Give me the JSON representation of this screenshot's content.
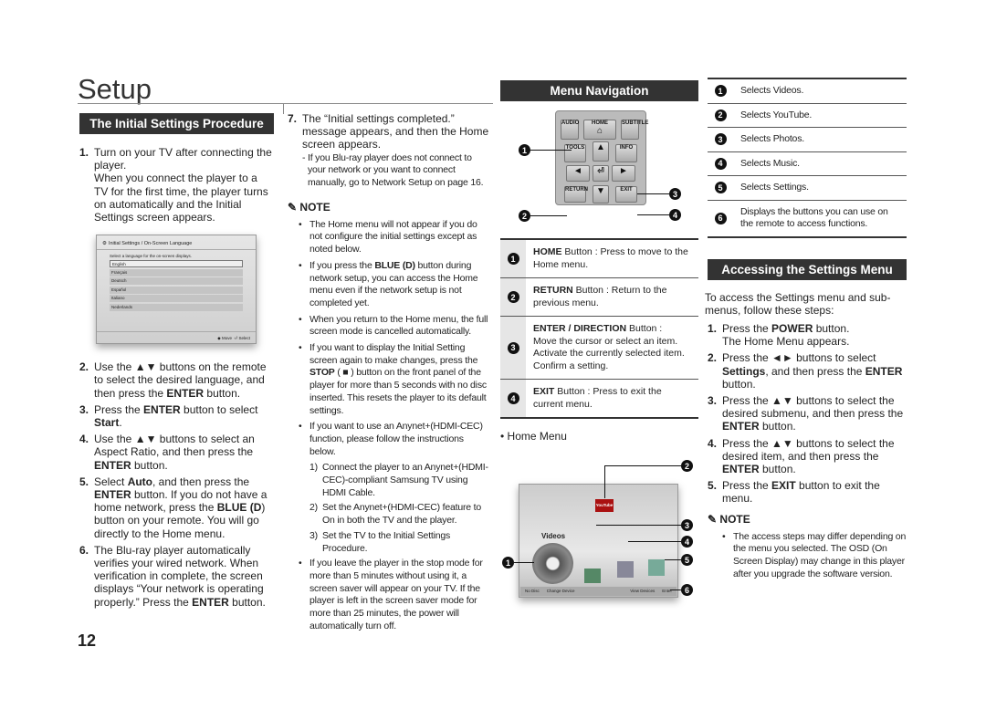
{
  "page": {
    "title": "Setup",
    "number": "12"
  },
  "initial": {
    "header": "The Initial Settings Procedure",
    "steps": [
      {
        "n": "1.",
        "segs": [
          "Turn on your TV after connecting the player.",
          "\nWhen you connect the player to a TV for the first time, the player turns on automatically and the Initial Settings screen appears."
        ]
      },
      {
        "n": "2.",
        "segs": [
          "Use the ▲▼ buttons on the remote to select the desired language, and then press the ",
          {
            "b": "ENTER"
          },
          " button."
        ]
      },
      {
        "n": "3.",
        "segs": [
          "Press the ",
          {
            "b": "ENTER"
          },
          " button to select ",
          {
            "b": "Start"
          },
          "."
        ]
      },
      {
        "n": "4.",
        "segs": [
          "Use the ▲▼ buttons to select an Aspect Ratio, and then press the ",
          {
            "b": "ENTER"
          },
          " button."
        ]
      },
      {
        "n": "5.",
        "segs": [
          "Select ",
          {
            "b": "Auto"
          },
          ", and then press the ",
          {
            "b": "ENTER"
          },
          " button. If you do not have a home network, press the ",
          {
            "b": "BLUE (D"
          },
          ") button on your remote. You will go directly to the Home menu."
        ]
      },
      {
        "n": "6.",
        "segs": [
          "The Blu-ray player automatically verifies your wired network. When verification in complete, the screen displays “Your network is operating properly.” Press the ",
          {
            "b": "ENTER"
          },
          " button."
        ]
      }
    ],
    "screen": {
      "title": "Initial Settings / On-Screen Language",
      "prompt": "Select a language for the on-screen displays.",
      "languages": [
        "English",
        "Français",
        "Deutsch",
        "Español",
        "Italiano",
        "Nederlands"
      ],
      "move": "◆ Move",
      "select": "⏎ Select"
    }
  },
  "col2": {
    "step7": {
      "n": "7.",
      "text": "The “Initial settings completed.” message appears, and then the Home screen appears.",
      "sub": "- If you Blu-ray player does not connect to your network or you want to connect manually, go to Network Setup on page 16."
    },
    "note_label": "NOTE",
    "bullets": [
      [
        "The Home menu will not appear if you do not configure the initial settings except as noted below."
      ],
      [
        "If you press the ",
        {
          "b": "BLUE (D)"
        },
        " button during network setup, you can access the Home menu even if the network setup is not completed yet."
      ],
      [
        "When you return to the Home menu, the full screen mode is cancelled automatically."
      ],
      [
        "If you want to display the Initial Setting screen again to make changes, press the ",
        {
          "b": "STOP"
        },
        " ( ■ ) button on the front panel of the player for more than 5 seconds with no disc inserted. This resets the player to its default settings."
      ],
      [
        "If you want to use an Anynet+(HDMI-CEC) function, please follow the instructions below."
      ]
    ],
    "anynet_steps": [
      {
        "n": "1)",
        "text": "Connect the player to an Anynet+(HDMI-CEC)-compliant Samsung TV using HDMI Cable."
      },
      {
        "n": "2)",
        "text": "Set the Anynet+(HDMI-CEC) feature to On in both the TV and the player."
      },
      {
        "n": "3)",
        "text": "Set the TV to the Initial Settings Procedure."
      }
    ],
    "last_bullet": "If you leave the player in the stop mode for more than 5 minutes without using it, a screen saver will appear on your TV. If the player is left in the screen saver mode for more than 25 minutes, the power will automatically turn off."
  },
  "menu_nav": {
    "header": "Menu Navigation",
    "remote": {
      "audio": "AUDIO",
      "home": "HOME",
      "subtitle": "SUBTITLE",
      "tools": "TOOLS",
      "info": "INFO",
      "return": "RETURN",
      "exit": "EXIT"
    },
    "callouts": [
      "1",
      "2",
      "3",
      "4"
    ],
    "rows": [
      {
        "n": "1",
        "segs": [
          {
            "b": "HOME"
          },
          " Button : Press to move to the Home menu."
        ]
      },
      {
        "n": "2",
        "segs": [
          {
            "b": "RETURN"
          },
          " Button : Return to the previous menu."
        ]
      },
      {
        "n": "3",
        "segs": [
          {
            "b": "ENTER / DIRECTION"
          },
          " Button :\nMove the cursor or select an item.\nActivate the currently selected item.\nConfirm a setting."
        ]
      },
      {
        "n": "4",
        "segs": [
          {
            "b": "EXIT"
          },
          " Button : Press to exit the current menu."
        ]
      }
    ],
    "home_menu_label": "Home Menu",
    "home_screen": {
      "youtube": "YouTube",
      "videos": "Videos",
      "no_disc": "No Disc",
      "change_device": "Change Device",
      "view_devices": "View Devices",
      "enter": "Enter",
      "callouts": [
        "1",
        "2",
        "3",
        "4",
        "5",
        "6"
      ]
    }
  },
  "col4": {
    "rows": [
      {
        "n": "1",
        "text": "Selects Videos."
      },
      {
        "n": "2",
        "text": "Selects YouTube."
      },
      {
        "n": "3",
        "text": "Selects Photos."
      },
      {
        "n": "4",
        "text": "Selects Music."
      },
      {
        "n": "5",
        "text": "Selects Settings."
      },
      {
        "n": "6",
        "text": "Displays the buttons you can use on the remote to access functions."
      }
    ],
    "header": "Accessing the Settings Menu",
    "intro": "To access the Settings menu and sub-menus, follow these steps:",
    "steps": [
      {
        "n": "1.",
        "segs": [
          "Press the ",
          {
            "b": "POWER"
          },
          " button.\nThe Home Menu appears."
        ]
      },
      {
        "n": "2.",
        "segs": [
          "Press the ◄► buttons to select ",
          {
            "b": "Settings"
          },
          ", and then press the ",
          {
            "b": "ENTER"
          },
          " button."
        ]
      },
      {
        "n": "3.",
        "segs": [
          "Press the ▲▼ buttons to select the desired submenu, and then press the ",
          {
            "b": "ENTER"
          },
          " button."
        ]
      },
      {
        "n": "4.",
        "segs": [
          "Press the ▲▼ buttons to select the desired item, and then press the ",
          {
            "b": "ENTER"
          },
          " button."
        ]
      },
      {
        "n": "5.",
        "segs": [
          "Press the ",
          {
            "b": "EXIT"
          },
          " button to exit the menu."
        ]
      }
    ],
    "note_label": "NOTE",
    "note": "The access steps may differ depending on the menu you selected. The OSD (On Screen Display) may change in this player after you upgrade the software version."
  },
  "icons": {
    "note": "pencil-note-icon",
    "gear": "gear-icon",
    "home": "home-icon"
  }
}
